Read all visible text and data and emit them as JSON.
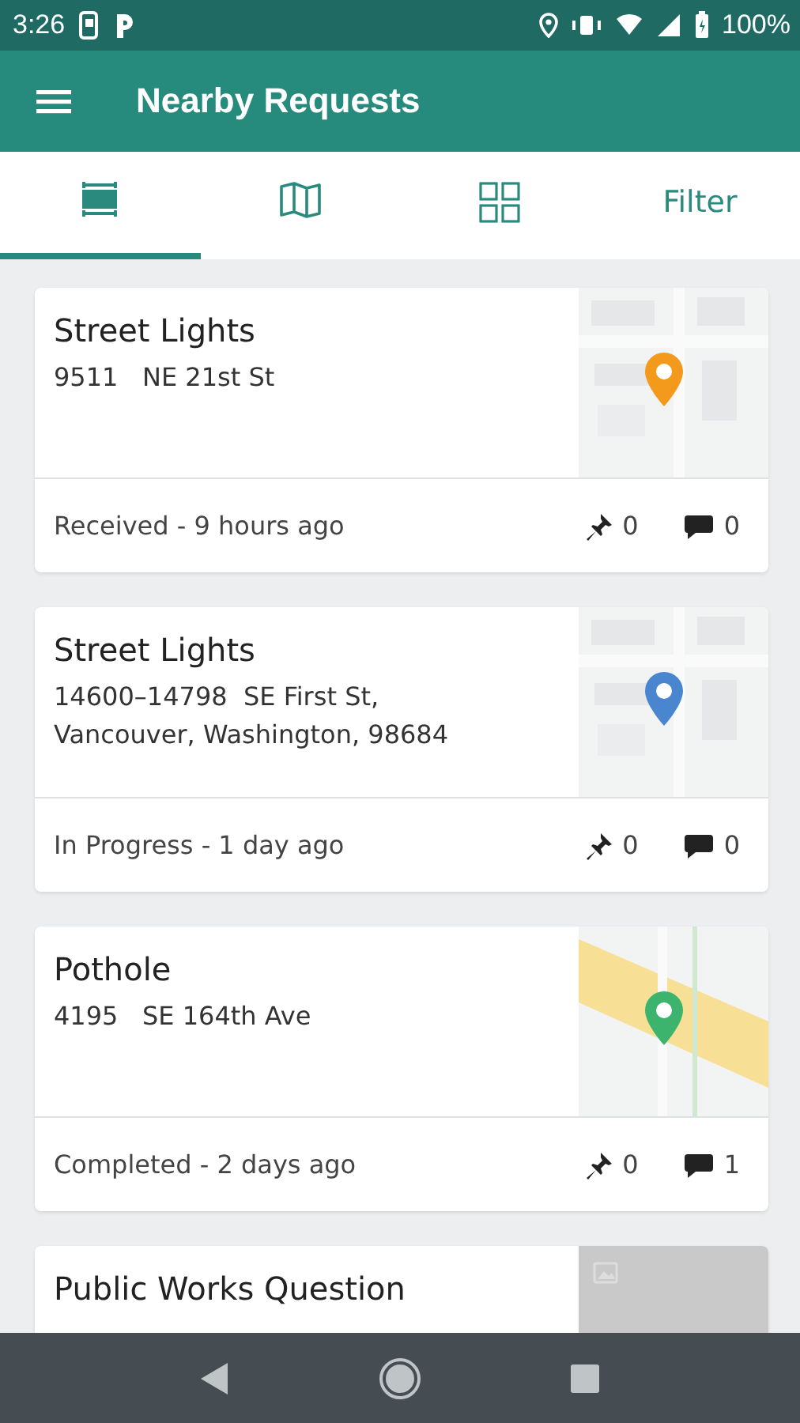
{
  "status_bar": {
    "time": "3:26",
    "battery": "100%"
  },
  "app_bar": {
    "title": "Nearby Requests"
  },
  "tabs": [
    {
      "kind": "list",
      "selected": true
    },
    {
      "kind": "map",
      "selected": false
    },
    {
      "kind": "grid",
      "selected": false
    },
    {
      "kind": "text",
      "label": "Filter",
      "selected": false
    }
  ],
  "requests": [
    {
      "title": "Street Lights",
      "address": [
        "9511   NE 21st St"
      ],
      "status": "Received - 9 hours ago",
      "pins": "0",
      "comments": "0",
      "thumbnail": {
        "kind": "map",
        "color": "#f39a1c"
      }
    },
    {
      "title": "Street Lights",
      "address": [
        "14600–14798  SE First St,",
        "Vancouver, Washington, 98684"
      ],
      "status": "In Progress - 1 day ago",
      "pins": "0",
      "comments": "0",
      "thumbnail": {
        "kind": "map",
        "color": "#4a86d0"
      }
    },
    {
      "title": "Pothole",
      "address": [
        "4195   SE 164th Ave"
      ],
      "status": "Completed - 2 days ago",
      "pins": "0",
      "comments": "1",
      "thumbnail": {
        "kind": "map",
        "color": "#3db46d"
      }
    },
    {
      "title": "Public Works Question",
      "thumbnail": {
        "kind": "none"
      }
    }
  ]
}
